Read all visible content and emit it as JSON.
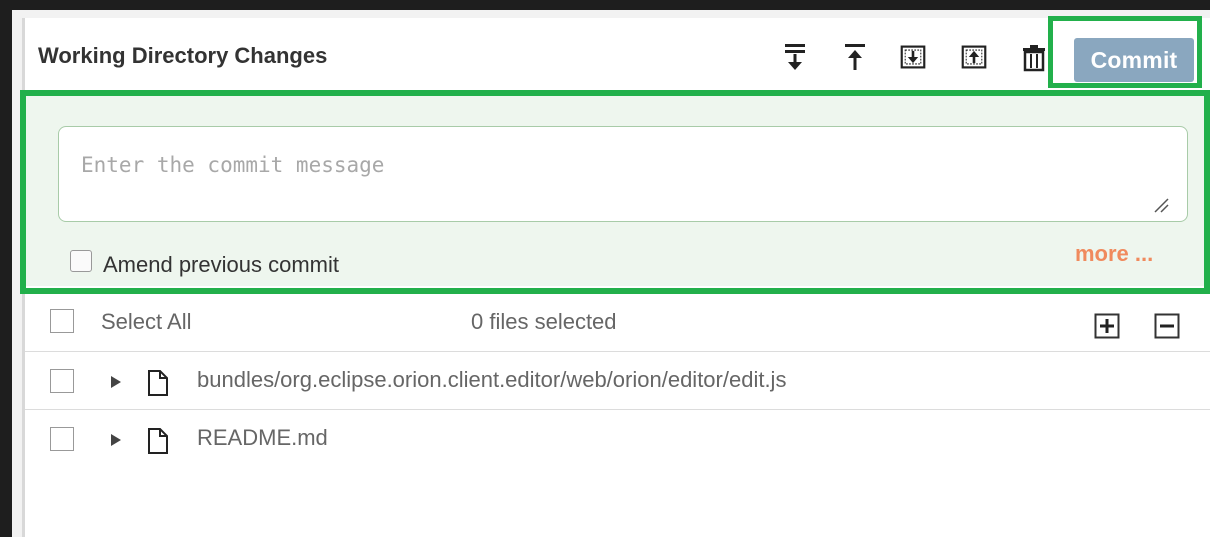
{
  "header": {
    "title": "Working Directory Changes",
    "commit_label": "Commit"
  },
  "toolbar": {
    "icons": [
      "download-all-icon",
      "upload-all-icon",
      "save-stash-icon",
      "apply-stash-icon",
      "trash-icon"
    ]
  },
  "commit_form": {
    "placeholder": "Enter the commit message",
    "amend_label": "Amend previous commit",
    "more_label": "more ..."
  },
  "list": {
    "select_all_label": "Select All",
    "selected_count": "0 files selected",
    "files": [
      {
        "path": "bundles/org.eclipse.orion.client.editor/web/orion/editor/edit.js"
      },
      {
        "path": "README.md"
      }
    ]
  },
  "colors": {
    "highlight": "#22b04b",
    "commit_button": "#8aa7bf",
    "more_link": "#f08a5d",
    "commit_area_bg": "#eef6ee"
  }
}
